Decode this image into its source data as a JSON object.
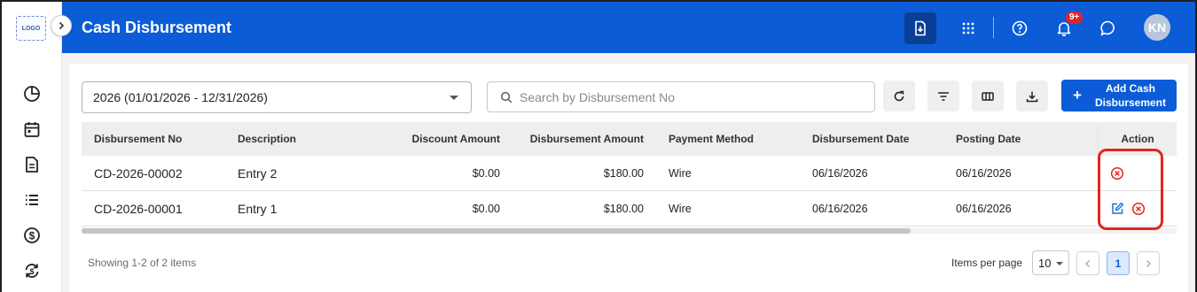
{
  "app": {
    "logo_text": "LOGO",
    "title": "Cash Disbursement",
    "notifications_badge": "9+",
    "user_initials": "KN"
  },
  "sidebar": {
    "items": [
      {
        "icon": "pie-chart-icon"
      },
      {
        "icon": "calendar-icon"
      },
      {
        "icon": "document-icon"
      },
      {
        "icon": "list-icon"
      },
      {
        "icon": "dollar-circle-icon"
      },
      {
        "icon": "currency-exchange-icon"
      }
    ]
  },
  "toolbar": {
    "period_select": "2026 (01/01/2026 - 12/31/2026)",
    "search_placeholder": "Search by Disbursement No",
    "add_label": "Add Cash Disbursement"
  },
  "table": {
    "columns": [
      "Disbursement No",
      "Description",
      "Discount Amount",
      "Disbursement Amount",
      "Payment Method",
      "Disbursement Date",
      "Posting Date",
      "Action"
    ],
    "rows": [
      {
        "no": "CD-2026-00002",
        "description": "Entry 2",
        "discount": "$0.00",
        "amount": "$180.00",
        "method": "Wire",
        "disb_date": "06/16/2026",
        "post_date": "06/16/2026",
        "actions": [
          "cancel"
        ]
      },
      {
        "no": "CD-2026-00001",
        "description": "Entry 1",
        "discount": "$0.00",
        "amount": "$180.00",
        "method": "Wire",
        "disb_date": "06/16/2026",
        "post_date": "06/16/2026",
        "actions": [
          "edit",
          "cancel"
        ]
      }
    ]
  },
  "footer": {
    "showing": "Showing 1-2 of 2 items",
    "items_per_page_label": "Items per page",
    "items_per_page": "10",
    "current_page": "1"
  },
  "colors": {
    "primary": "#0b5cd6",
    "header_active": "#0a3f96",
    "danger": "#e1251b",
    "badge": "#e0242b"
  }
}
